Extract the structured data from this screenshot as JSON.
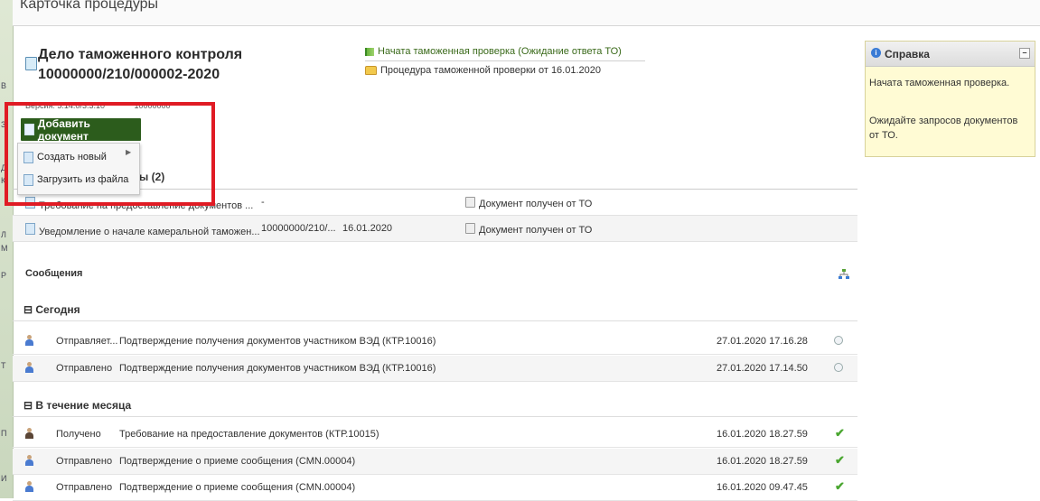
{
  "window": {
    "title": "Карточка процедуры"
  },
  "case": {
    "title": "Дело таможенного контроля 10000000/210/000002-2020",
    "version_label": "Версия: 5.14.0/3.3.10",
    "version_number": "10000000"
  },
  "status": {
    "current": "Начата таможенная проверка (Ожидание ответа ТО)",
    "procedure_link": "Процедура таможенной проверки от 16.01.2020"
  },
  "add_document": {
    "button_label": "Добавить документ",
    "menu": [
      {
        "label": "Создать новый",
        "has_submenu": true
      },
      {
        "label": "Загрузить из файла",
        "has_submenu": false
      }
    ]
  },
  "documents": {
    "section_title_visible": "ы (2)",
    "rows": [
      {
        "name": "Требование на предоставление документов ...",
        "number": "-",
        "date": "",
        "status": "Документ получен от ТО"
      },
      {
        "name": "Уведомление о начале камеральной таможен...",
        "number": "10000000/210/...",
        "date": "16.01.2020",
        "status": "Документ получен от ТО"
      }
    ]
  },
  "messages": {
    "title": "Сообщения",
    "groups": [
      {
        "label": "Сегодня",
        "rows": [
          {
            "direction": "Отправляет...",
            "text": "Подтверждение получения документов участником ВЭД (КТР.10016)",
            "timestamp": "27.01.2020 17.16.28",
            "state": "pending"
          },
          {
            "direction": "Отправлено",
            "text": "Подтверждение получения документов участником ВЭД (КТР.10016)",
            "timestamp": "27.01.2020 17.14.50",
            "state": "pending"
          }
        ]
      },
      {
        "label": "В течение месяца",
        "rows": [
          {
            "direction": "Получено",
            "text": "Требование на предоставление документов (КТР.10015)",
            "timestamp": "16.01.2020 18.27.59",
            "state": "done"
          },
          {
            "direction": "Отправлено",
            "text": "Подтверждение о приеме сообщения (CMN.00004)",
            "timestamp": "16.01.2020 18.27.59",
            "state": "done"
          },
          {
            "direction": "Отправлено",
            "text": "Подтверждение о приеме сообщения (CMN.00004)",
            "timestamp": "16.01.2020 09.47.45",
            "state": "done"
          }
        ]
      }
    ]
  },
  "help": {
    "title": "Справка",
    "collapse_symbol": "–",
    "paragraph1": "Начата таможенная проверка.",
    "paragraph2": "Ожидайте запросов документов от ТО."
  },
  "left_strip_letters": [
    "В",
    "З",
    "Д",
    "К",
    "Л",
    "М",
    "Р",
    "Т",
    "П",
    "И"
  ],
  "colors": {
    "accent_green": "#2c5c1c",
    "highlight_red": "#e01b24",
    "help_bg": "#fffbd4",
    "check_green": "#4aa630"
  },
  "icons": {
    "status_current": "green-flag-icon",
    "procedure_link": "folder-icon",
    "add_document": "document-icon",
    "create_new": "new-document-icon",
    "upload": "upload-file-icon",
    "doc_row": "document-icon",
    "received": "attachment-icon",
    "messages_tree": "hierarchy-icon",
    "person": "person-icon",
    "pending": "clock-icon",
    "done": "checkmark-icon",
    "help": "info-icon"
  }
}
